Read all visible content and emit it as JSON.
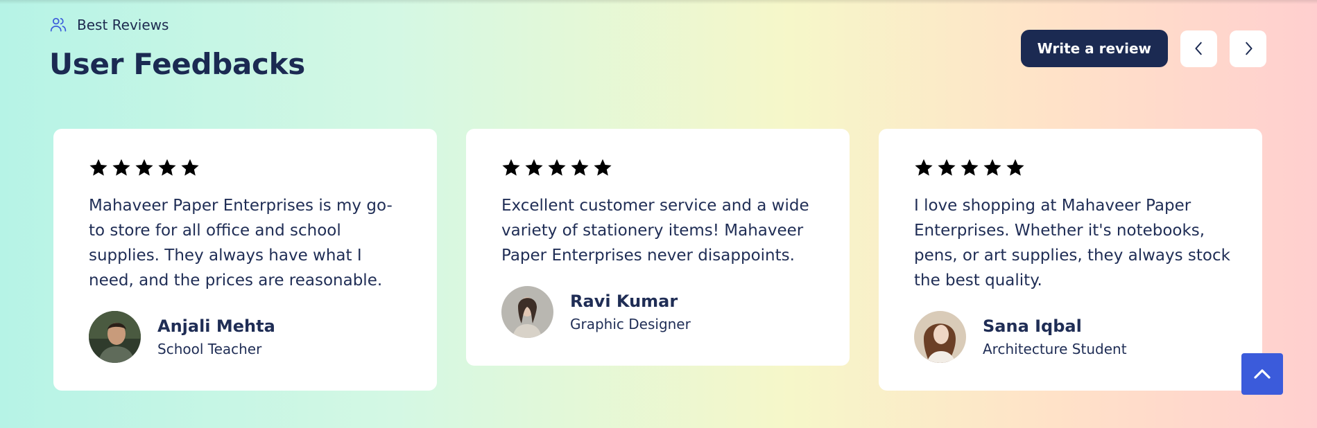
{
  "header": {
    "eyebrow_icon": "users-icon",
    "eyebrow": "Best Reviews",
    "title": "User Feedbacks"
  },
  "controls": {
    "write_review_label": "Write a review",
    "prev_icon": "chevron-left-icon",
    "next_icon": "chevron-right-icon"
  },
  "reviews": [
    {
      "rating": 5,
      "text": "Mahaveer Paper Enterprises is my go-to store for all office and school supplies. They always have what I need, and the prices are reasonable.",
      "name": "Anjali Mehta",
      "role": "School Teacher"
    },
    {
      "rating": 5,
      "text": "Excellent customer service and a wide variety of stationery items! Mahaveer Paper Enterprises never disappoints.",
      "name": "Ravi Kumar",
      "role": "Graphic Designer"
    },
    {
      "rating": 5,
      "text": "I love shopping at Mahaveer Paper Enterprises. Whether it's notebooks, pens, or art supplies, they always stock the best quality.",
      "name": "Sana Iqbal",
      "role": "Architecture Student"
    }
  ],
  "scroll_top_icon": "chevron-up-icon",
  "colors": {
    "accent_navy": "#1b2a52",
    "scroll_button": "#3b5bdb",
    "card_bg": "#ffffff"
  }
}
